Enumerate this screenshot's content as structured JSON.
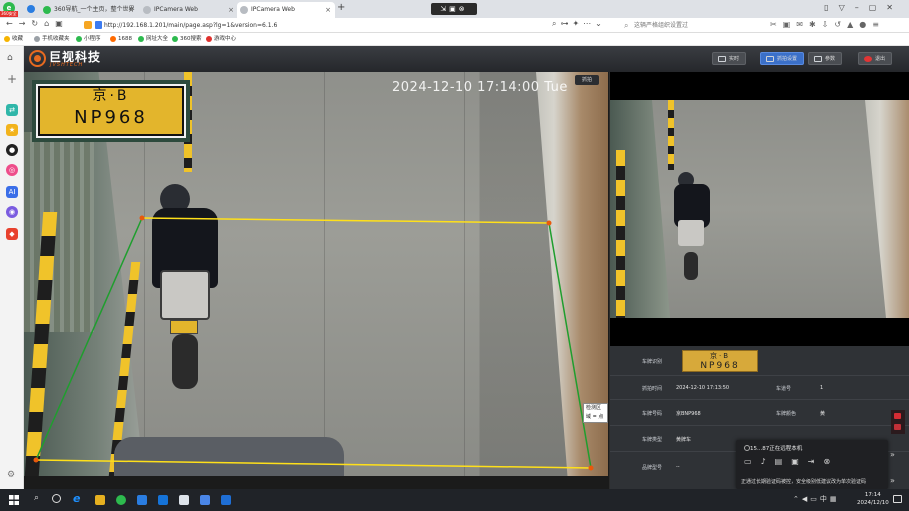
{
  "browser": {
    "tabs": [
      {
        "label": "360导航_一个主页，整个世界",
        "active": false
      },
      {
        "label": "IPCamera Web",
        "active": false
      },
      {
        "label": "IPCamera Web",
        "active": true
      }
    ],
    "brand_badge": "360安全",
    "address": "http://192.168.1.201/main/page.asp?lg=1&version=6.1.6",
    "search_placeholder": "这辆严格组织设置过",
    "bookmarks": [
      "收藏",
      "手机收藏夹",
      "小程序",
      "1688",
      "网址大全",
      "360搜索",
      "游戏中心"
    ]
  },
  "app": {
    "name": "巨视科技",
    "subtitle": "JVSHTECH",
    "header_buttons": [
      {
        "label": "实时",
        "icon": "monitor-icon"
      },
      {
        "label": "抓拍设置",
        "icon": "camera-icon"
      },
      {
        "label": "参数",
        "icon": "list-icon"
      },
      {
        "label": "退出",
        "icon": "power-icon"
      }
    ]
  },
  "video": {
    "timestamp": "2024-12-10 17:14:00 Tue",
    "tag_label": "抓拍",
    "plate_line1": "京·B",
    "plate_line2": "NP968",
    "zone_label": "检测区域 = 点"
  },
  "info": {
    "rows": [
      {
        "label": "车牌识别",
        "value": ""
      },
      {
        "label": "抓拍时间",
        "value": "2024-12-10 17:13:50",
        "label2": "车道号",
        "value2": "1"
      },
      {
        "label": "车牌号码",
        "value": "京BNP968",
        "label2": "车牌颜色",
        "value2": "黄"
      },
      {
        "label": "车牌类型",
        "value": "黄牌车",
        "label2": "",
        "value2": ""
      },
      {
        "label": "品牌型号",
        "value": "--",
        "label2": "",
        "value2": ""
      }
    ],
    "plate_line1": "京·B",
    "plate_line2": "NP968"
  },
  "notification": {
    "title": "15...87正在远程本机",
    "message": "正通过长期验证码被控，安全级别低建议改为单次验证码",
    "icons": [
      "chat-icon",
      "mic-icon",
      "clipboard-icon",
      "file-icon",
      "screen-icon",
      "close-icon"
    ]
  },
  "taskbar": {
    "time": "17:14",
    "date": "2024/12/10",
    "tray_lang": "中"
  },
  "colors": {
    "accent": "#3b70c9",
    "zone_yellow": "#ffe01a",
    "zone_green": "#1f9e2e",
    "zone_point": "#e8590c",
    "plate_yellow": "#e3b52c"
  }
}
